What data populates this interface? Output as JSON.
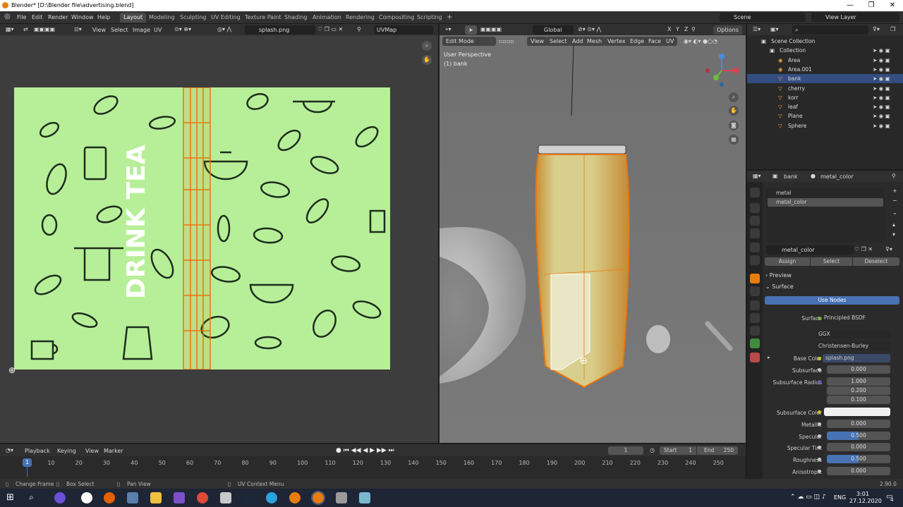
{
  "window": {
    "title": "Blender* [D:\\Blender file\\advertising.blend]",
    "minimize": "—",
    "maximize": "❐",
    "close": "✕"
  },
  "menu": {
    "items": [
      "File",
      "Edit",
      "Render",
      "Window",
      "Help"
    ]
  },
  "workspaces": {
    "tabs": [
      "Layout",
      "Modeling",
      "Sculpting",
      "UV Editing",
      "Texture Paint",
      "Shading",
      "Animation",
      "Rendering",
      "Compositing",
      "Scripting"
    ],
    "active": "Layout",
    "add": "+"
  },
  "scene": {
    "name": "Scene",
    "view_layer": "View Layer"
  },
  "uv_editor": {
    "menus": [
      "View",
      "Select",
      "Image",
      "UV"
    ],
    "image_name": "splash.png",
    "uvmap": "UVMap",
    "image_text": "DRINK TEA"
  },
  "viewport": {
    "mode": "Edit Mode",
    "menus": [
      "View",
      "Select",
      "Add",
      "Mesh",
      "Vertex",
      "Edge",
      "Face",
      "UV"
    ],
    "orientation": "Global",
    "options": "Options",
    "view_name": "User Perspective",
    "object_label": "(1) bank",
    "axes": [
      "X",
      "Y",
      "Z"
    ]
  },
  "outliner": {
    "search_placeholder": "",
    "rows": [
      {
        "name": "Scene Collection",
        "level": 0,
        "selected": false
      },
      {
        "name": "Collection",
        "level": 1,
        "selected": false
      },
      {
        "name": "Area",
        "level": 2,
        "selected": false
      },
      {
        "name": "Area.001",
        "level": 2,
        "selected": false
      },
      {
        "name": "bank",
        "level": 2,
        "selected": true
      },
      {
        "name": "cherry",
        "level": 2,
        "selected": false
      },
      {
        "name": "korr",
        "level": 2,
        "selected": false
      },
      {
        "name": "leaf",
        "level": 2,
        "selected": false
      },
      {
        "name": "Plane",
        "level": 2,
        "selected": false
      },
      {
        "name": "Sphere",
        "level": 2,
        "selected": false
      }
    ]
  },
  "properties": {
    "object": "bank",
    "material": "metal_color",
    "slots": [
      "metal",
      "metal_color"
    ],
    "material_field": "metal_color",
    "assign": "Assign",
    "select": "Select",
    "deselect": "Deselect",
    "preview": "Preview",
    "surface_panel": "Surface",
    "use_nodes": "Use Nodes",
    "surface_label": "Surface",
    "surface_value": "Principled BSDF",
    "distribution": "GGX",
    "subsurface_method": "Christensen-Burley",
    "base_color_label": "Base Color",
    "base_color_value": "splash.png",
    "subsurface_label": "Subsurface",
    "subsurface_value": "0.000",
    "ss_radius_label": "Subsurface Radius",
    "ss_radius": [
      "1.000",
      "0.200",
      "0.100"
    ],
    "ss_color_label": "Subsurface Color",
    "metallic_label": "Metallic",
    "metallic_value": "0.000",
    "specular_label": "Specular",
    "specular_value": "0.500",
    "spec_tint_label": "Specular Tint",
    "spec_tint_value": "0.000",
    "roughness_label": "Roughness",
    "roughness_value": "0.500",
    "anisotropic_label": "Anisotropic",
    "anisotropic_value": "0.000"
  },
  "timeline": {
    "menus": [
      "Playback",
      "Keying",
      "View",
      "Marker"
    ],
    "current_frame": "1",
    "start_label": "Start",
    "start": "1",
    "end_label": "End",
    "end": "250",
    "ticks": [
      "1",
      "10",
      "20",
      "30",
      "40",
      "50",
      "60",
      "70",
      "80",
      "90",
      "100",
      "110",
      "120",
      "130",
      "140",
      "150",
      "160",
      "170",
      "180",
      "190",
      "200",
      "210",
      "220",
      "230",
      "240",
      "250"
    ]
  },
  "statusbar": {
    "change_frame": "Change Frame",
    "box_select": "Box Select",
    "pan_view": "Pan View",
    "context": "UV Context Menu",
    "version": "2.90.0"
  },
  "taskbar": {
    "lang": "ENG",
    "time": "3:01",
    "date": "27.12.2020",
    "notif": "4"
  },
  "colors": {
    "accent": "#4772b3",
    "uv_bg": "#b7ef98",
    "selected": "#334d80",
    "orange": "#e87d0d"
  }
}
